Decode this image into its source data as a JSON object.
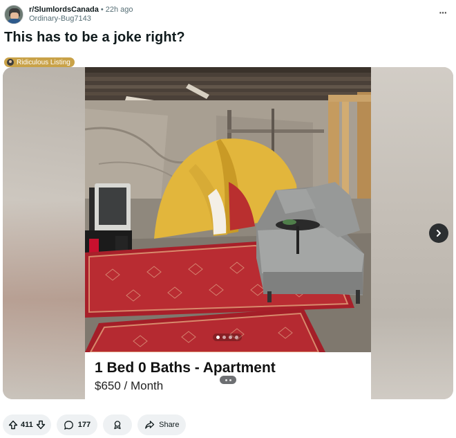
{
  "post": {
    "subreddit": "r/SlumlordsCanada",
    "separator": "•",
    "time_ago": "22h ago",
    "author": "Ordinary-Bug7143",
    "title": "This has to be a joke right?",
    "flair": "Ridiculous Listing",
    "overflow_label": "···"
  },
  "media": {
    "listing_title": "1 Bed 0 Baths - Apartment",
    "listing_price": "$650 / Month",
    "carousel_count": 4,
    "carousel_active": 1
  },
  "actions": {
    "upvotes": "411",
    "comments": "177",
    "share_label": "Share"
  },
  "icons": {
    "upvote": "arrow-up-icon",
    "downvote": "arrow-down-icon",
    "comment": "comment-bubble-icon",
    "award": "award-icon",
    "share": "share-arrow-icon",
    "next": "chevron-right-icon"
  },
  "colors": {
    "flair_bg": "#c9a248",
    "pill_bg": "#eef1f3",
    "text_primary": "#0f1a1c",
    "text_secondary": "#576f76"
  }
}
